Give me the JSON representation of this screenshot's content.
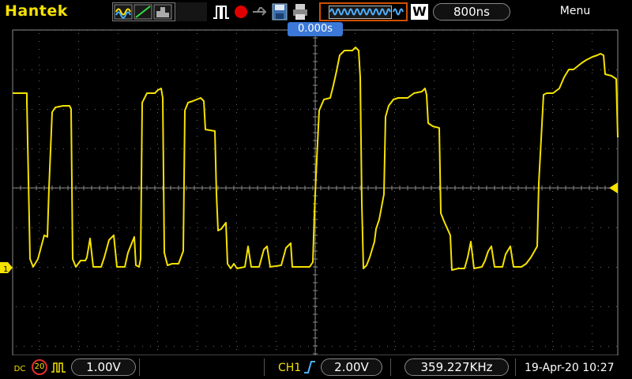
{
  "header": {
    "brand": "Hantek",
    "timebase": "800ns",
    "trigger_status": "W",
    "menu_label": "Menu"
  },
  "grid": {
    "trigger_position": "0.000s",
    "ch1_marker_label": "1"
  },
  "footer": {
    "coupling": "DC",
    "probe": "20",
    "ch1_scale": "1.00V",
    "trigger_source": "CH1",
    "trigger_level": "2.00V",
    "frequency": "359.227KHz",
    "datetime": "19-Apr-20 10:27"
  },
  "colors": {
    "ch1_trace": "#f5e200",
    "trigger_badge": "#3b78d8",
    "stop_indicator": "#e00000",
    "memory_frame": "#d05000"
  }
}
